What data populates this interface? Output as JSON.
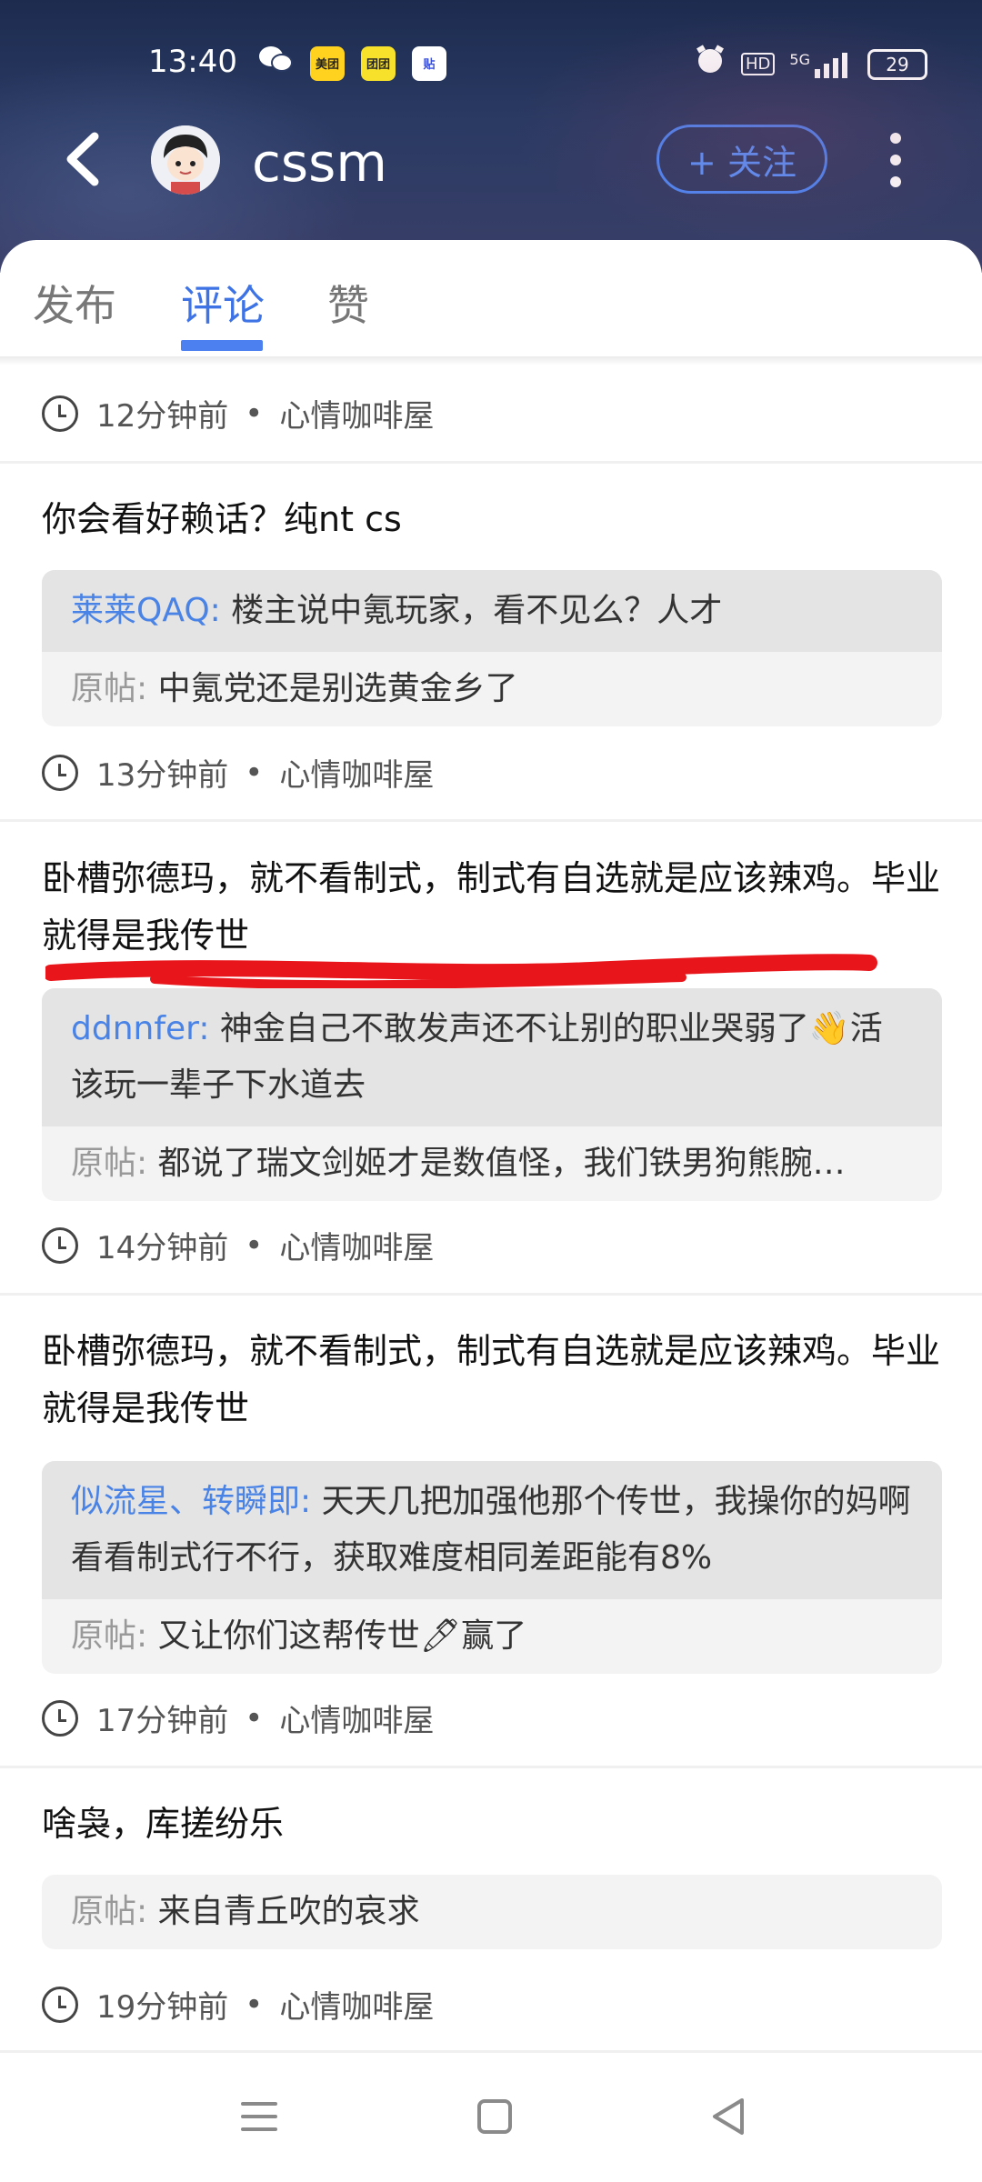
{
  "status_bar": {
    "time": "13:40",
    "apps": [
      "美团",
      "团团",
      "贴"
    ],
    "battery": "29",
    "network": "5G"
  },
  "header": {
    "username": "cssm",
    "follow_label": "+ 关注"
  },
  "tabs": [
    {
      "label": "发布",
      "active": false
    },
    {
      "label": "评论",
      "active": true
    },
    {
      "label": "赞",
      "active": false
    }
  ],
  "origin_label": "原帖:",
  "first_meta": {
    "time": "12分钟前",
    "forum": "心情咖啡屋"
  },
  "comments": [
    {
      "text": "你会看好赖话？纯nt cs",
      "reply_user": "莱莱QAQ:",
      "reply_text": "楼主说中氪玩家，看不见么？人才",
      "origin": "中氪党还是别选黄金乡了",
      "time": "13分钟前",
      "forum": "心情咖啡屋"
    },
    {
      "text": "卧槽弥德玛，就不看制式，制式有自选就是应该辣鸡。毕业就得是我传世",
      "reply_user": "ddnnfer:",
      "reply_text": "神金自己不敢发声还不让别的职业哭弱了👋活该玩一辈子下水道去",
      "origin": "都说了瑞文剑姬才是数值怪，我们铁男狗熊腕…",
      "time": "14分钟前",
      "forum": "心情咖啡屋"
    },
    {
      "text": "卧槽弥德玛，就不看制式，制式有自选就是应该辣鸡。毕业就得是我传世",
      "reply_user": "似流星、转瞬即:",
      "reply_text": "天天几把加强他那个传世，我操你的妈啊看看制式行不行，获取难度相同差距能有8%",
      "origin": "又让你们这帮传世🖊赢了",
      "time": "17分钟前",
      "forum": "心情咖啡屋"
    },
    {
      "text": "啥袅，库搓纷乐",
      "origin": "来自青丘吹的哀求",
      "time": "19分钟前",
      "forum": "心情咖啡屋"
    }
  ],
  "dot_separator": "•",
  "colors": {
    "accent": "#3e73e6",
    "reply_user": "#4a83e6",
    "annotation": "#e8161b"
  }
}
